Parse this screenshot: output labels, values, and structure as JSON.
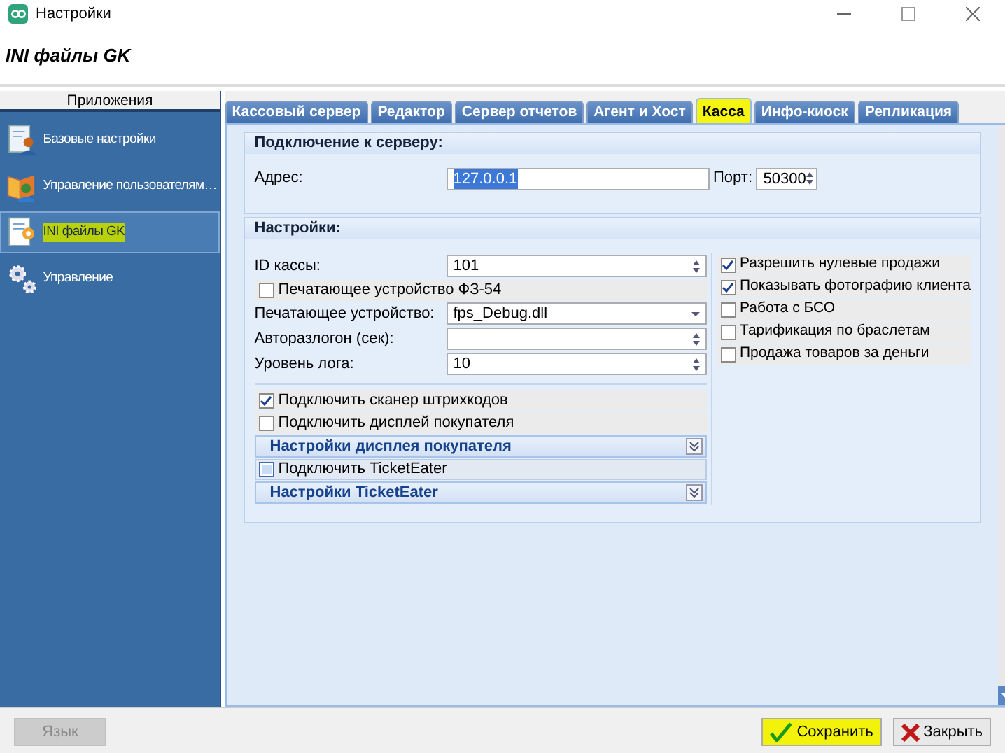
{
  "window": {
    "title": "Настройки"
  },
  "header": {
    "title": "INI файлы GK"
  },
  "sidebar": {
    "title": "Приложения",
    "items": [
      {
        "label": "Базовые настройки",
        "selected": false,
        "highlighted": false
      },
      {
        "label": "Управление пользователям…",
        "selected": false,
        "highlighted": false
      },
      {
        "label": "INI файлы GK",
        "selected": true,
        "highlighted": true
      },
      {
        "label": "Управление",
        "selected": false,
        "highlighted": false
      }
    ]
  },
  "tabs": [
    {
      "label": "Кассовый сервер",
      "selected": false,
      "highlighted": false
    },
    {
      "label": "Редактор",
      "selected": false,
      "highlighted": false
    },
    {
      "label": "Сервер отчетов",
      "selected": false,
      "highlighted": false
    },
    {
      "label": "Агент и Хост",
      "selected": false,
      "highlighted": false
    },
    {
      "label": "Касса",
      "selected": true,
      "highlighted": true
    },
    {
      "label": "Инфо-киоск",
      "selected": false,
      "highlighted": false
    },
    {
      "label": "Репликация",
      "selected": false,
      "highlighted": false
    }
  ],
  "connection": {
    "title": "Подключение к серверу:",
    "address_label": "Адрес:",
    "address_value": "127.0.0.1",
    "port_label": "Порт:",
    "port_value": "50300"
  },
  "settings": {
    "title": "Настройки:",
    "left_rows": [
      {
        "kind": "spin",
        "label": "ID кассы:",
        "value": "101"
      },
      {
        "kind": "check",
        "label": "Печатающее устройство ФЗ-54",
        "checked": false,
        "focused": false
      },
      {
        "kind": "combo",
        "label": "Печатающее устройство:",
        "value": "fps_Debug.dll"
      },
      {
        "kind": "spin",
        "label": "Авторазлогон (сек):"
      },
      {
        "kind": "spin",
        "label": "Уровень лога:",
        "value": "10"
      },
      {
        "kind": "separator"
      },
      {
        "kind": "check",
        "label": "Подключить сканер штрихкодов",
        "checked": true,
        "focused": false
      },
      {
        "kind": "check",
        "label": "Подключить дисплей покупателя",
        "checked": false,
        "focused": false
      },
      {
        "kind": "section",
        "label": "Настройки дисплея покупателя",
        "expanded": false
      },
      {
        "kind": "check",
        "label": "Подключить TicketEater",
        "checked": false,
        "focused": true
      },
      {
        "kind": "section",
        "label": "Настройки TicketEater",
        "expanded": false
      }
    ],
    "right_rows": [
      {
        "label": "Разрешить нулевые продажи",
        "checked": true
      },
      {
        "label": "Показывать фотографию клиента",
        "checked": true
      },
      {
        "label": "Работа с БСО",
        "checked": false
      },
      {
        "label": "Тарификация по браслетам",
        "checked": false
      },
      {
        "label": "Продажа товаров за деньги",
        "checked": false
      }
    ]
  },
  "footer": {
    "buttons": [
      {
        "label": "Язык",
        "kind": "plain",
        "disabled": true,
        "highlighted": false
      },
      {
        "label": "Сохранить",
        "kind": "save",
        "disabled": false,
        "highlighted": true
      },
      {
        "label": "Закрыть",
        "kind": "close",
        "disabled": false,
        "highlighted": false
      }
    ]
  }
}
